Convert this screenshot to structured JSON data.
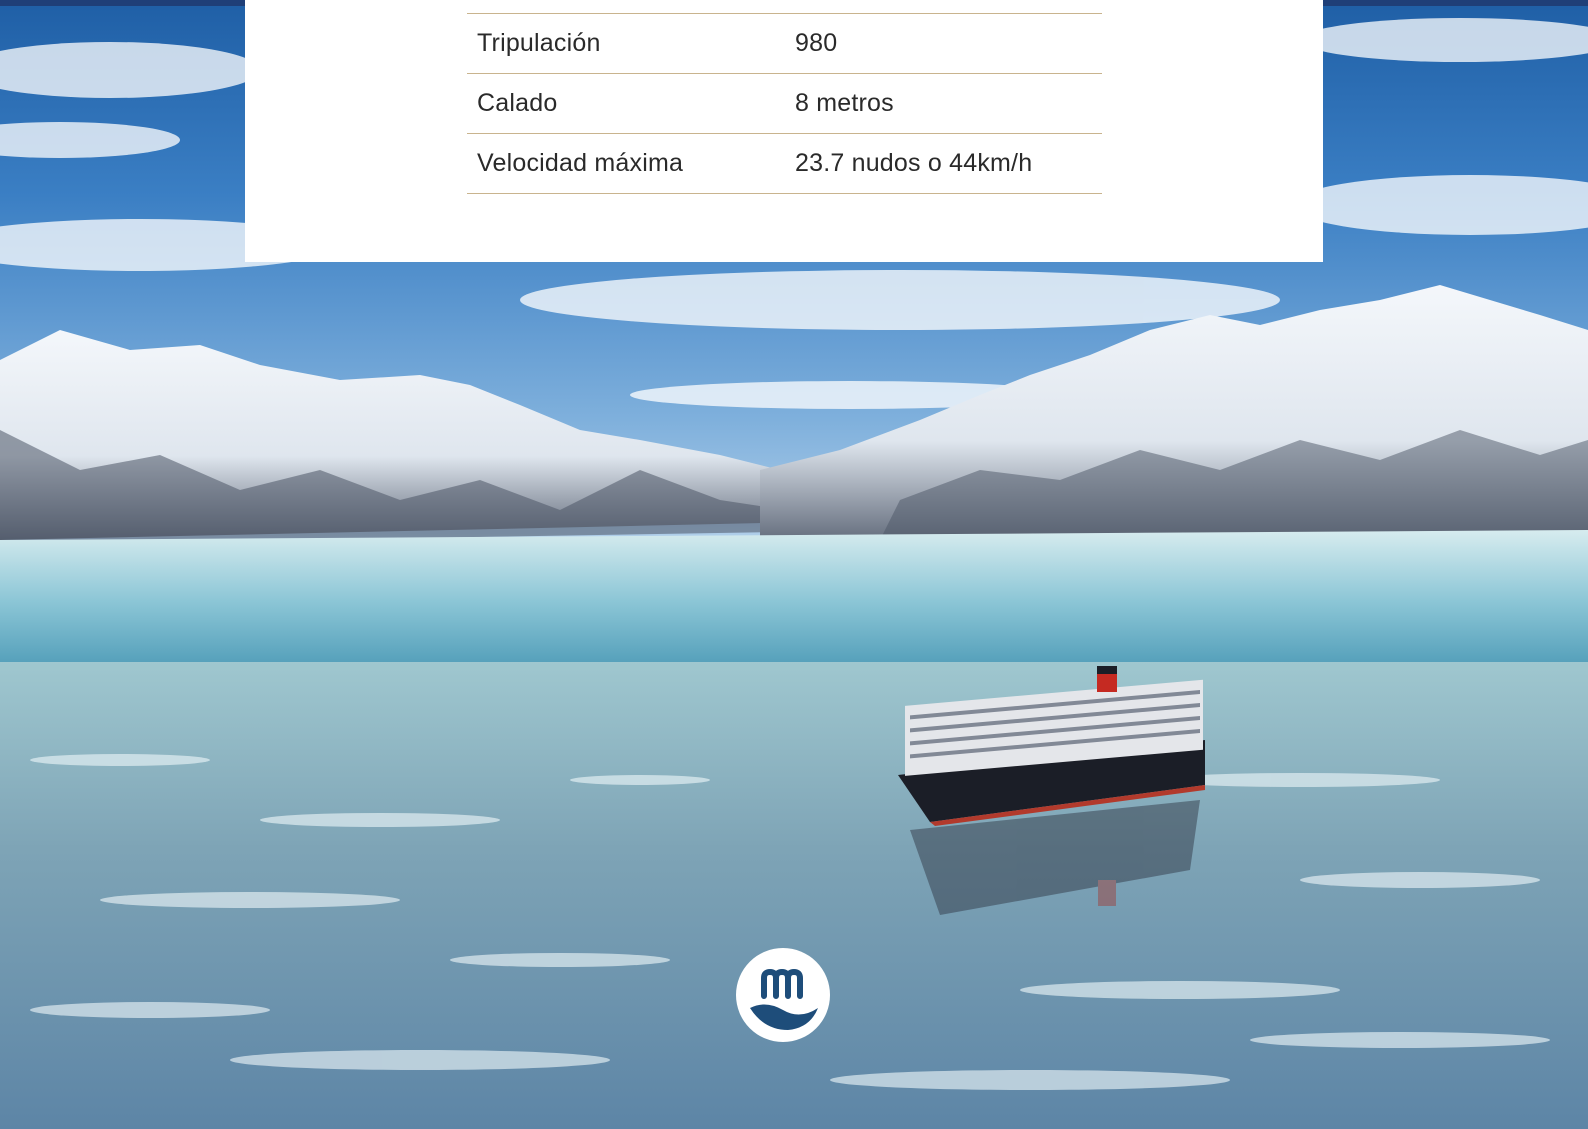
{
  "specs": {
    "rows": [
      {
        "label": "Tripulación",
        "value": "980"
      },
      {
        "label": "Calado",
        "value": "8 metros"
      },
      {
        "label": "Velocidad máxima",
        "value": "23.7 nudos o 44km/h"
      }
    ]
  },
  "logo": {
    "icon": "brand-m-wave-icon",
    "color": "#ffffff",
    "accent": "#1e4d7a"
  },
  "colors": {
    "rule": "#c9b48e",
    "text": "#2a2a2a",
    "card": "#ffffff"
  }
}
